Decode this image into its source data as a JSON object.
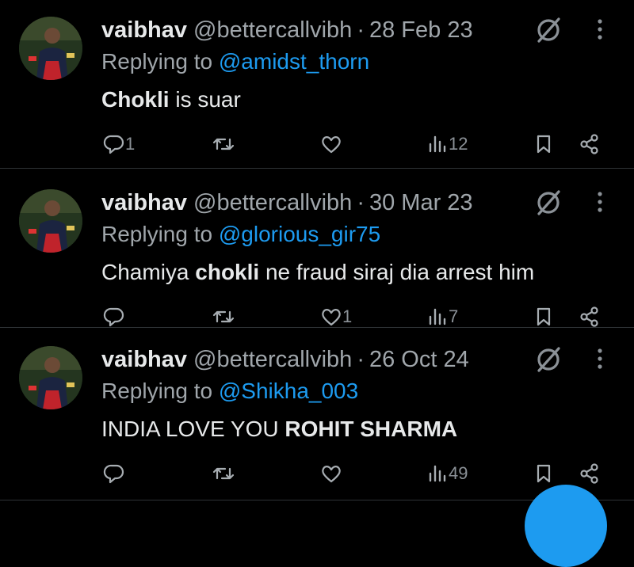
{
  "tweets": [
    {
      "name": "vaibhav",
      "handle": "@bettercallvibh",
      "separator": "·",
      "date": "28 Feb 23",
      "replying_prefix": "Replying to ",
      "replying_to": "@amidst_thorn",
      "text_bold_1": "Chokli",
      "text_rest_1": " is suar",
      "text_pre": "",
      "text_post": "",
      "reply_count": "1",
      "retweet_count": "",
      "like_count": "",
      "views": "12"
    },
    {
      "name": "vaibhav",
      "handle": "@bettercallvibh",
      "separator": "·",
      "date": "30 Mar 23",
      "replying_prefix": "Replying to ",
      "replying_to": "@glorious_gir75",
      "text_pre": "Chamiya ",
      "text_bold_1": "chokli",
      "text_rest_1": " ne fraud siraj dia arrest him",
      "reply_count": "",
      "retweet_count": "",
      "like_count": "1",
      "views": "7"
    },
    {
      "name": "vaibhav",
      "handle": "@bettercallvibh",
      "separator": "·",
      "date": "26 Oct 24",
      "replying_prefix": "Replying to ",
      "replying_to": "@Shikha_003",
      "text_pre": "INDIA LOVE YOU ",
      "text_bold_1": "ROHIT SHARMA",
      "text_rest_1": "",
      "reply_count": "",
      "retweet_count": "",
      "like_count": "",
      "views": "49"
    }
  ],
  "icons": {
    "reply": "reply-icon",
    "retweet": "retweet-icon",
    "like": "heart-icon",
    "views": "views-icon",
    "bookmark": "bookmark-icon",
    "share": "share-icon",
    "grok": "grok-icon",
    "more": "more-vertical-icon",
    "compose": "compose-fab"
  },
  "colors": {
    "background": "#000000",
    "text": "#e7e9ea",
    "muted": "#a0a6ab",
    "link": "#1d9bf0",
    "divider": "#2f3336"
  }
}
